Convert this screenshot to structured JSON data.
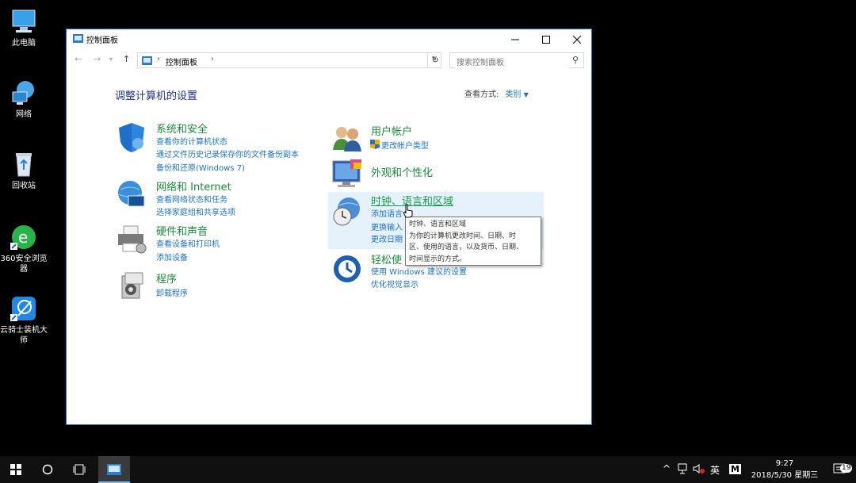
{
  "desktop": {
    "icons": [
      {
        "label": "此电脑"
      },
      {
        "label": "网络"
      },
      {
        "label": "回收站"
      },
      {
        "label": "360安全浏览器"
      },
      {
        "label": "云骑士装机大师"
      }
    ]
  },
  "window": {
    "title": "控制面板",
    "breadcrumb": "控制面板",
    "search_placeholder": "搜索控制面板",
    "heading": "调整计算机的设置",
    "view_by_label": "查看方式:",
    "view_by_value": "类别"
  },
  "categories": {
    "system": {
      "title": "系统和安全",
      "links": [
        "查看你的计算机状态",
        "通过文件历史记录保存你的文件备份副本",
        "备份和还原(Windows 7)"
      ]
    },
    "network": {
      "title": "网络和 Internet",
      "links": [
        "查看网络状态和任务",
        "选择家庭组和共享选项"
      ]
    },
    "hardware": {
      "title": "硬件和声音",
      "links": [
        "查看设备和打印机",
        "添加设备"
      ]
    },
    "programs": {
      "title": "程序",
      "links": [
        "卸载程序"
      ]
    },
    "users": {
      "title": "用户帐户",
      "links": [
        "更改帐户类型"
      ]
    },
    "appearance": {
      "title": "外观和个性化",
      "links": []
    },
    "clock": {
      "title": "时钟、语言和区域",
      "links": [
        "添加语言",
        "更换输入",
        "更改日期"
      ]
    },
    "ease": {
      "title": "轻松使",
      "links": [
        "使用 Windows 建议的设置",
        "优化视觉显示"
      ]
    }
  },
  "tooltip": {
    "lines": [
      "时钟、语言和区域",
      "为你的计算机更改时间、日期、时",
      "区、使用的语言，以及货币、日期、",
      "时间显示的方式。"
    ]
  },
  "taskbar": {
    "ime": "英",
    "ime2": "M",
    "time": "9:27",
    "date": "2018/5/30 星期三",
    "notif_count": "19"
  }
}
